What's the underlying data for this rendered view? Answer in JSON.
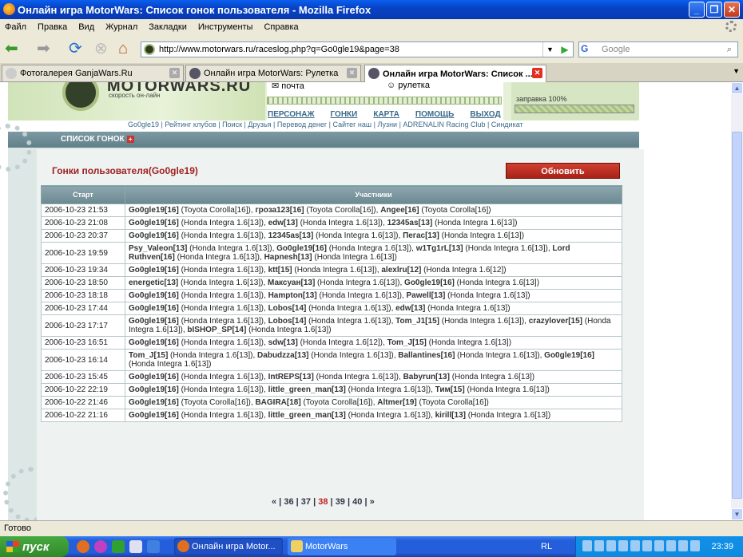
{
  "window": {
    "title": "Онлайн игра MotorWars: Список гонок пользователя - Mozilla Firefox",
    "minimize": "_",
    "maximize": "❐",
    "close": "✕"
  },
  "menu": [
    "Файл",
    "Правка",
    "Вид",
    "Журнал",
    "Закладки",
    "Инструменты",
    "Справка"
  ],
  "address": {
    "url": "http://www.motorwars.ru/raceslog.php?q=Go0gle19&page=38"
  },
  "search": {
    "engine": "G",
    "placeholder": "Google"
  },
  "tabs": [
    {
      "label": "Фотогалерея GanjaWars.Ru",
      "active": false
    },
    {
      "label": "Онлайн игра MotorWars: Рулетка",
      "active": false
    },
    {
      "label": "Онлайн игра MotorWars: Список ...",
      "active": true
    }
  ],
  "site": {
    "brand": "MOTORWARS.RU",
    "slogan": "скорость он-лайн",
    "top_links": {
      "mail": "почта",
      "roulette": "рулетка"
    },
    "nav": [
      "ПЕРСОНАЖ",
      "ГОНКИ",
      "КАРТА",
      "ПОМОЩЬ",
      "ВЫХОД"
    ],
    "fuel": "заправка 100%",
    "sublinks": "Go0gle19 | Рейтинг клубов | Поиск | Друзья | Перевод денег | Сайтег наш | Лузни | ADRENALIN Racing Club | Синдикат",
    "panel_header": "СПИСОК ГОНОК",
    "panel_plus": "+",
    "page_title": "Гонки пользователя(Go0gle19)",
    "refresh_button": "Обновить",
    "table_headers": [
      "Старт",
      "Участники"
    ]
  },
  "races": [
    {
      "date": "2006-10-23 21:53",
      "p": [
        [
          "Go0gle19[16]",
          "Toyota Corolla[16]"
        ],
        [
          "гроза123[16]",
          "Toyota Corolla[16]"
        ],
        [
          "Angee[16]",
          "Toyota Corolla[16]"
        ]
      ]
    },
    {
      "date": "2006-10-23 21:08",
      "p": [
        [
          "Go0gle19[16]",
          "Honda Integra 1.6[13]"
        ],
        [
          "edw[13]",
          "Honda Integra 1.6[13]"
        ],
        [
          "12345as[13]",
          "Honda Integra 1.6[13]"
        ]
      ]
    },
    {
      "date": "2006-10-23 20:37",
      "p": [
        [
          "Go0gle19[16]",
          "Honda Integra 1.6[13]"
        ],
        [
          "12345as[13]",
          "Honda Integra 1.6[13]"
        ],
        [
          "Пегас[13]",
          "Honda Integra 1.6[13]"
        ]
      ]
    },
    {
      "date": "2006-10-23 19:59",
      "p": [
        [
          "Psy_Valeon[13]",
          "Honda Integra 1.6[13]"
        ],
        [
          "Go0gle19[16]",
          "Honda Integra 1.6[13]"
        ],
        [
          "w1Tg1rL[13]",
          "Honda Integra 1.6[13]"
        ],
        [
          "Lord Ruthven[16]",
          "Honda Integra 1.6[13]"
        ],
        [
          "Hapnesh[13]",
          "Honda Integra 1.6[13]"
        ]
      ]
    },
    {
      "date": "2006-10-23 19:34",
      "p": [
        [
          "Go0gle19[16]",
          "Honda Integra 1.6[13]"
        ],
        [
          "ktt[15]",
          "Honda Integra 1.6[13]"
        ],
        [
          "alexlru[12]",
          "Honda Integra 1.6[12]"
        ]
      ]
    },
    {
      "date": "2006-10-23 18:50",
      "p": [
        [
          "energetic[13]",
          "Honda Integra 1.6[13]"
        ],
        [
          "Максуан[13]",
          "Honda Integra 1.6[13]"
        ],
        [
          "Go0gle19[16]",
          "Honda Integra 1.6[13]"
        ]
      ]
    },
    {
      "date": "2006-10-23 18:18",
      "p": [
        [
          "Go0gle19[16]",
          "Honda Integra 1.6[13]"
        ],
        [
          "Hampton[13]",
          "Honda Integra 1.6[13]"
        ],
        [
          "Pawell[13]",
          "Honda Integra 1.6[13]"
        ]
      ]
    },
    {
      "date": "2006-10-23 17:44",
      "p": [
        [
          "Go0gle19[16]",
          "Honda Integra 1.6[13]"
        ],
        [
          "Lobos[14]",
          "Honda Integra 1.6[13]"
        ],
        [
          "edw[13]",
          "Honda Integra 1.6[13]"
        ]
      ]
    },
    {
      "date": "2006-10-23 17:17",
      "p": [
        [
          "Go0gle19[16]",
          "Honda Integra 1.6[13]"
        ],
        [
          "Lobos[14]",
          "Honda Integra 1.6[13]"
        ],
        [
          "Tom_J1[15]",
          "Honda Integra 1.6[13]"
        ],
        [
          "crazylover[15]",
          "Honda Integra 1.6[13]"
        ],
        [
          "bISHOP_SP[14]",
          "Honda Integra 1.6[13]"
        ]
      ]
    },
    {
      "date": "2006-10-23 16:51",
      "p": [
        [
          "Go0gle19[16]",
          "Honda Integra 1.6[13]"
        ],
        [
          "sdw[13]",
          "Honda Integra 1.6[12]"
        ],
        [
          "Tom_J[15]",
          "Honda Integra 1.6[13]"
        ]
      ]
    },
    {
      "date": "2006-10-23 16:14",
      "p": [
        [
          "Tom_J[15]",
          "Honda Integra 1.6[13]"
        ],
        [
          "Dabudzza[13]",
          "Honda Integra 1.6[13]"
        ],
        [
          "Ballantines[16]",
          "Honda Integra 1.6[13]"
        ],
        [
          "Go0gle19[16]",
          "Honda Integra 1.6[13]"
        ]
      ]
    },
    {
      "date": "2006-10-23 15:45",
      "p": [
        [
          "Go0gle19[16]",
          "Honda Integra 1.6[13]"
        ],
        [
          "IntREPS[13]",
          "Honda Integra 1.6[13]"
        ],
        [
          "Babyrun[13]",
          "Honda Integra 1.6[13]"
        ]
      ]
    },
    {
      "date": "2006-10-22 22:19",
      "p": [
        [
          "Go0gle19[16]",
          "Honda Integra 1.6[13]"
        ],
        [
          "little_green_man[13]",
          "Honda Integra 1.6[13]"
        ],
        [
          "Тим[15]",
          "Honda Integra 1.6[13]"
        ]
      ]
    },
    {
      "date": "2006-10-22 21:46",
      "p": [
        [
          "Go0gle19[16]",
          "Toyota Corolla[16]"
        ],
        [
          "BAGIRA[18]",
          "Toyota Corolla[16]"
        ],
        [
          "Altmer[19]",
          "Toyota Corolla[16]"
        ]
      ]
    },
    {
      "date": "2006-10-22 21:16",
      "p": [
        [
          "Go0gle19[16]",
          "Honda Integra 1.6[13]"
        ],
        [
          "little_green_man[13]",
          "Honda Integra 1.6[13]"
        ],
        [
          "kirill[13]",
          "Honda Integra 1.6[13]"
        ]
      ]
    }
  ],
  "pager": {
    "prev": "«",
    "pages": [
      "36",
      "37",
      "38",
      "39",
      "40"
    ],
    "current": "38",
    "next": "»"
  },
  "status": "Готово",
  "taskbar": {
    "start": "пуск",
    "tasks": [
      "Онлайн игра Motor...",
      "MotorWars"
    ],
    "lang": "RL",
    "time": "23:39"
  }
}
